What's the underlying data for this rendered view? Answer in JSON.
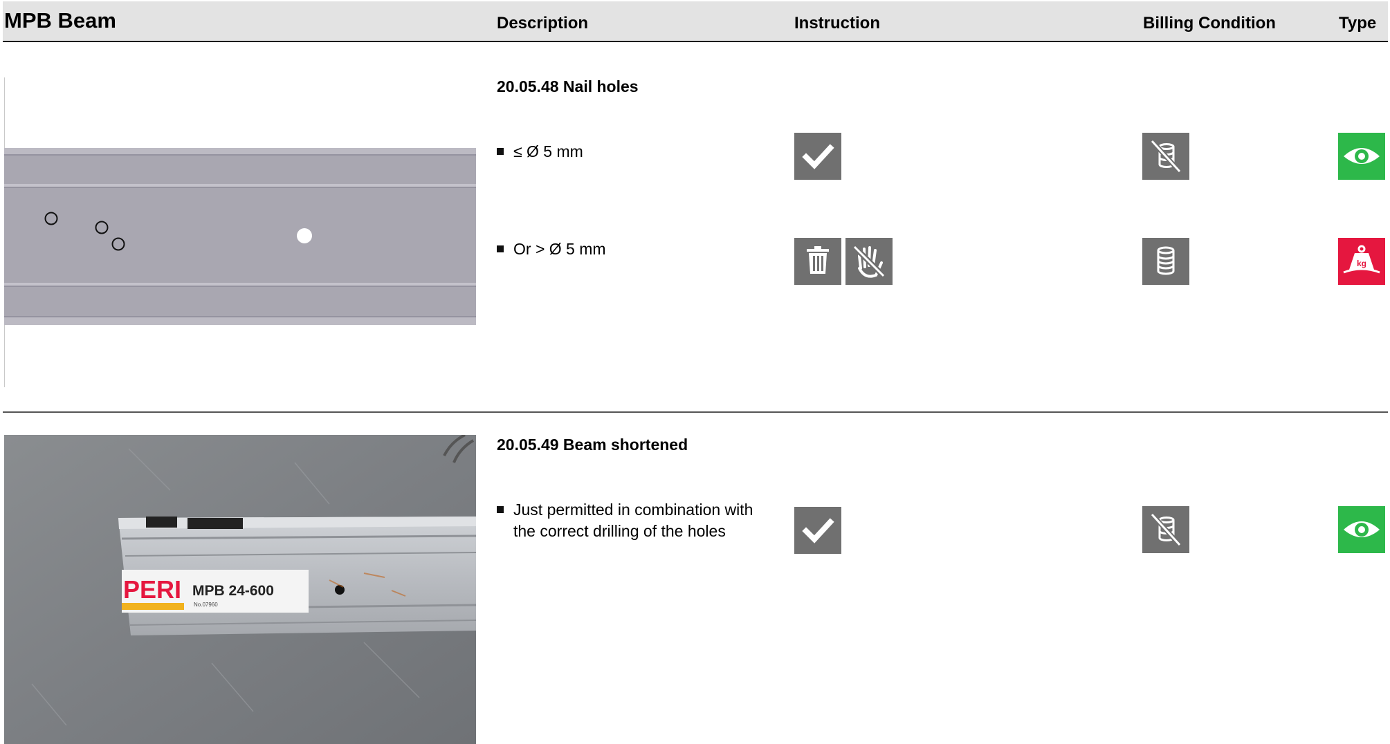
{
  "header": {
    "title": "MPB Beam",
    "col_description": "Description",
    "col_instruction": "Instruction",
    "col_billing": "Billing Condition",
    "col_type": "Type"
  },
  "entries": [
    {
      "title": "20.05.48 Nail holes",
      "rows": [
        {
          "text": "≤ Ø 5 mm",
          "instruction_icons": [
            "checkmark-icon"
          ],
          "billing_icon": "no-charge-icon",
          "type_icon": "visual-inspection-icon",
          "type_color": "#2db84a"
        },
        {
          "text": "Or > Ø 5 mm",
          "instruction_icons": [
            "trash-icon",
            "do-not-touch-icon"
          ],
          "billing_icon": "charge-icon",
          "type_icon": "weight-icon",
          "type_color": "#e5173f"
        }
      ]
    },
    {
      "title": "20.05.49 Beam shortened",
      "rows": [
        {
          "text_line1": "Just permitted in combination with",
          "text_line2": "the correct drilling of the holes",
          "instruction_icons": [
            "checkmark-icon"
          ],
          "billing_icon": "no-charge-icon",
          "type_icon": "visual-inspection-icon",
          "type_color": "#2db84a"
        }
      ]
    }
  ],
  "photo": {
    "brand": "PERI",
    "product": "MPB 24-600",
    "serial": "No.07960"
  },
  "colors": {
    "header_bg": "#e3e3e3",
    "icon_gray": "#707070",
    "green": "#2db84a",
    "red": "#e5173f"
  }
}
